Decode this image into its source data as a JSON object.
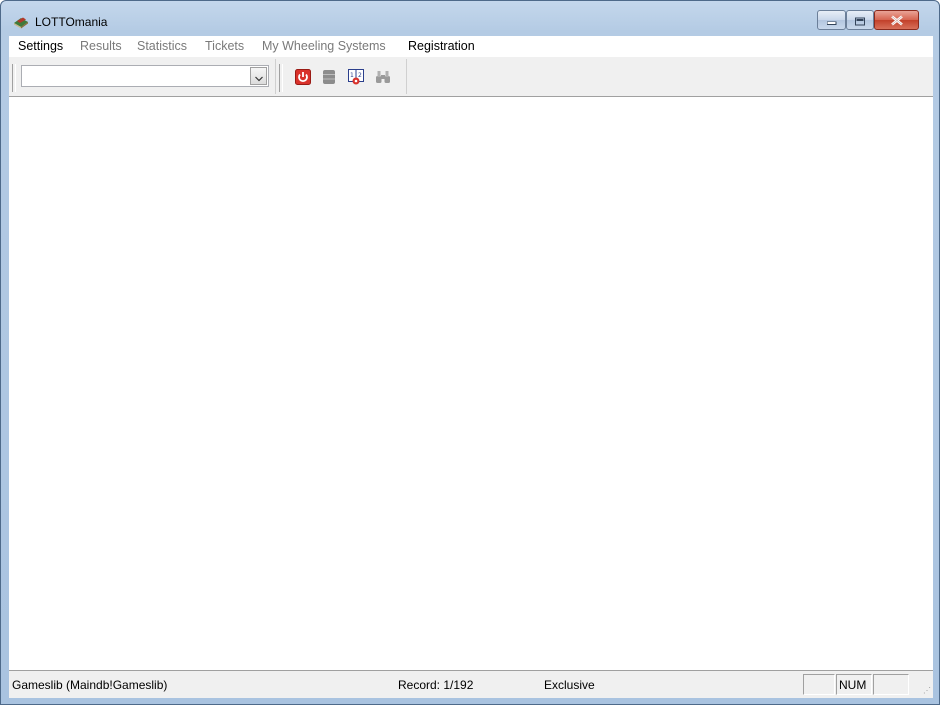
{
  "window": {
    "title": "LOTTOmania",
    "icons": {
      "app": "lottery-book-icon",
      "minimize": "minimize-icon",
      "maximize": "maximize-icon",
      "close": "close-icon"
    }
  },
  "menubar": {
    "items": [
      {
        "label": "Settings",
        "enabled": true
      },
      {
        "label": "Results",
        "enabled": false
      },
      {
        "label": "Statistics",
        "enabled": false
      },
      {
        "label": "Tickets",
        "enabled": false
      },
      {
        "label": "My Wheeling Systems",
        "enabled": false
      },
      {
        "label": "Registration",
        "enabled": true
      }
    ]
  },
  "toolbar": {
    "combo": {
      "value": "",
      "icon": "chevron-down-icon"
    },
    "buttons": [
      {
        "name": "power-button",
        "icon": "power-icon",
        "enabled": true,
        "color": "#d9322b"
      },
      {
        "name": "database-button",
        "icon": "database-icon",
        "enabled": false,
        "color": "#8c8c8c"
      },
      {
        "name": "numbers-button",
        "icon": "numbers-grid-icon",
        "enabled": true,
        "color": "#2b3f8c"
      },
      {
        "name": "search-button",
        "icon": "binoculars-icon",
        "enabled": false,
        "color": "#9a9a9a"
      }
    ]
  },
  "statusbar": {
    "database": "Gameslib (Maindb!Gameslib)",
    "record": "Record: 1/192",
    "mode": "Exclusive",
    "panels": [
      "",
      "NUM",
      ""
    ]
  }
}
